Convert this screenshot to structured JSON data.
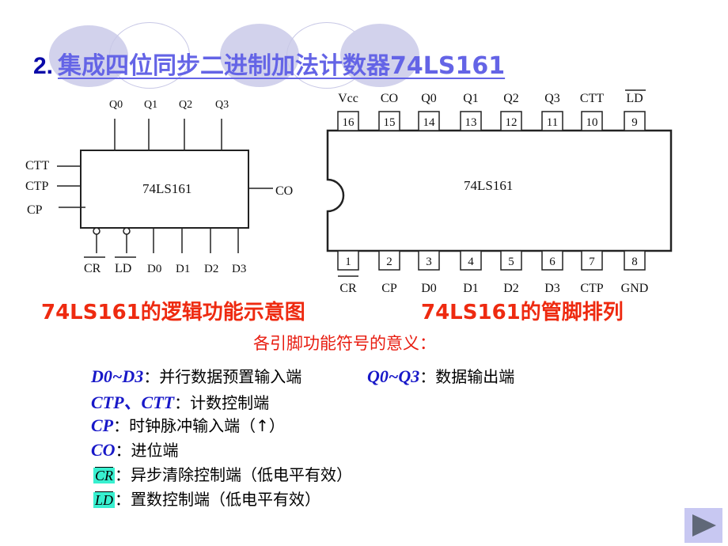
{
  "title": {
    "number": "2.",
    "text": "集成四位同步二进制加法计数器74LS161"
  },
  "logic_diagram": {
    "chip_label": "74LS161",
    "top_pins": [
      "Q0",
      "Q1",
      "Q2",
      "Q3"
    ],
    "left_pins": [
      "CTT",
      "CTP",
      "CP"
    ],
    "right_pins": [
      "CO"
    ],
    "bottom_pins": [
      "CR",
      "LD",
      "D0",
      "D1",
      "D2",
      "D3"
    ],
    "caption": "74LS161的逻辑功能示意图"
  },
  "pinout": {
    "chip_label": "74LS161",
    "top_row": [
      {
        "num": "16",
        "name": "Vcc"
      },
      {
        "num": "15",
        "name": "CO"
      },
      {
        "num": "14",
        "name": "Q0"
      },
      {
        "num": "13",
        "name": "Q1"
      },
      {
        "num": "12",
        "name": "Q2"
      },
      {
        "num": "11",
        "name": "Q3"
      },
      {
        "num": "10",
        "name": "CTT"
      },
      {
        "num": "9",
        "name": "LD"
      }
    ],
    "bottom_row": [
      {
        "num": "1",
        "name": "CR"
      },
      {
        "num": "2",
        "name": "CP"
      },
      {
        "num": "3",
        "name": "D0"
      },
      {
        "num": "4",
        "name": "D1"
      },
      {
        "num": "5",
        "name": "D2"
      },
      {
        "num": "6",
        "name": "D3"
      },
      {
        "num": "7",
        "name": "CTP"
      },
      {
        "num": "8",
        "name": "GND"
      }
    ],
    "caption": "74LS161的管脚排列"
  },
  "subtitle": "各引脚功能符号的意义：",
  "definitions": {
    "d": {
      "sym": "D0~D3",
      "desc": "：并行数据预置输入端"
    },
    "q": {
      "sym": "Q0~Q3",
      "desc": "：数据输出端"
    },
    "ct": {
      "sym": "CTP、CTT",
      "desc": "：计数控制端"
    },
    "cp": {
      "sym": "CP",
      "desc": "：时钟脉冲输入端（↑）"
    },
    "co": {
      "sym": "CO",
      "desc": "：进位端"
    },
    "cr": {
      "sym": "CR",
      "desc": "：异步清除控制端（低电平有效）"
    },
    "ld": {
      "sym": "LD",
      "desc": "：置数控制端（低电平有效）"
    }
  },
  "nav": {
    "next_icon": "play-triangle-icon"
  },
  "colors": {
    "title_number": "#0a0aa8",
    "title_text": "#6464e6",
    "caption": "#ee2a10",
    "symbol": "#1818c8",
    "highlight": "#38f0d0"
  }
}
